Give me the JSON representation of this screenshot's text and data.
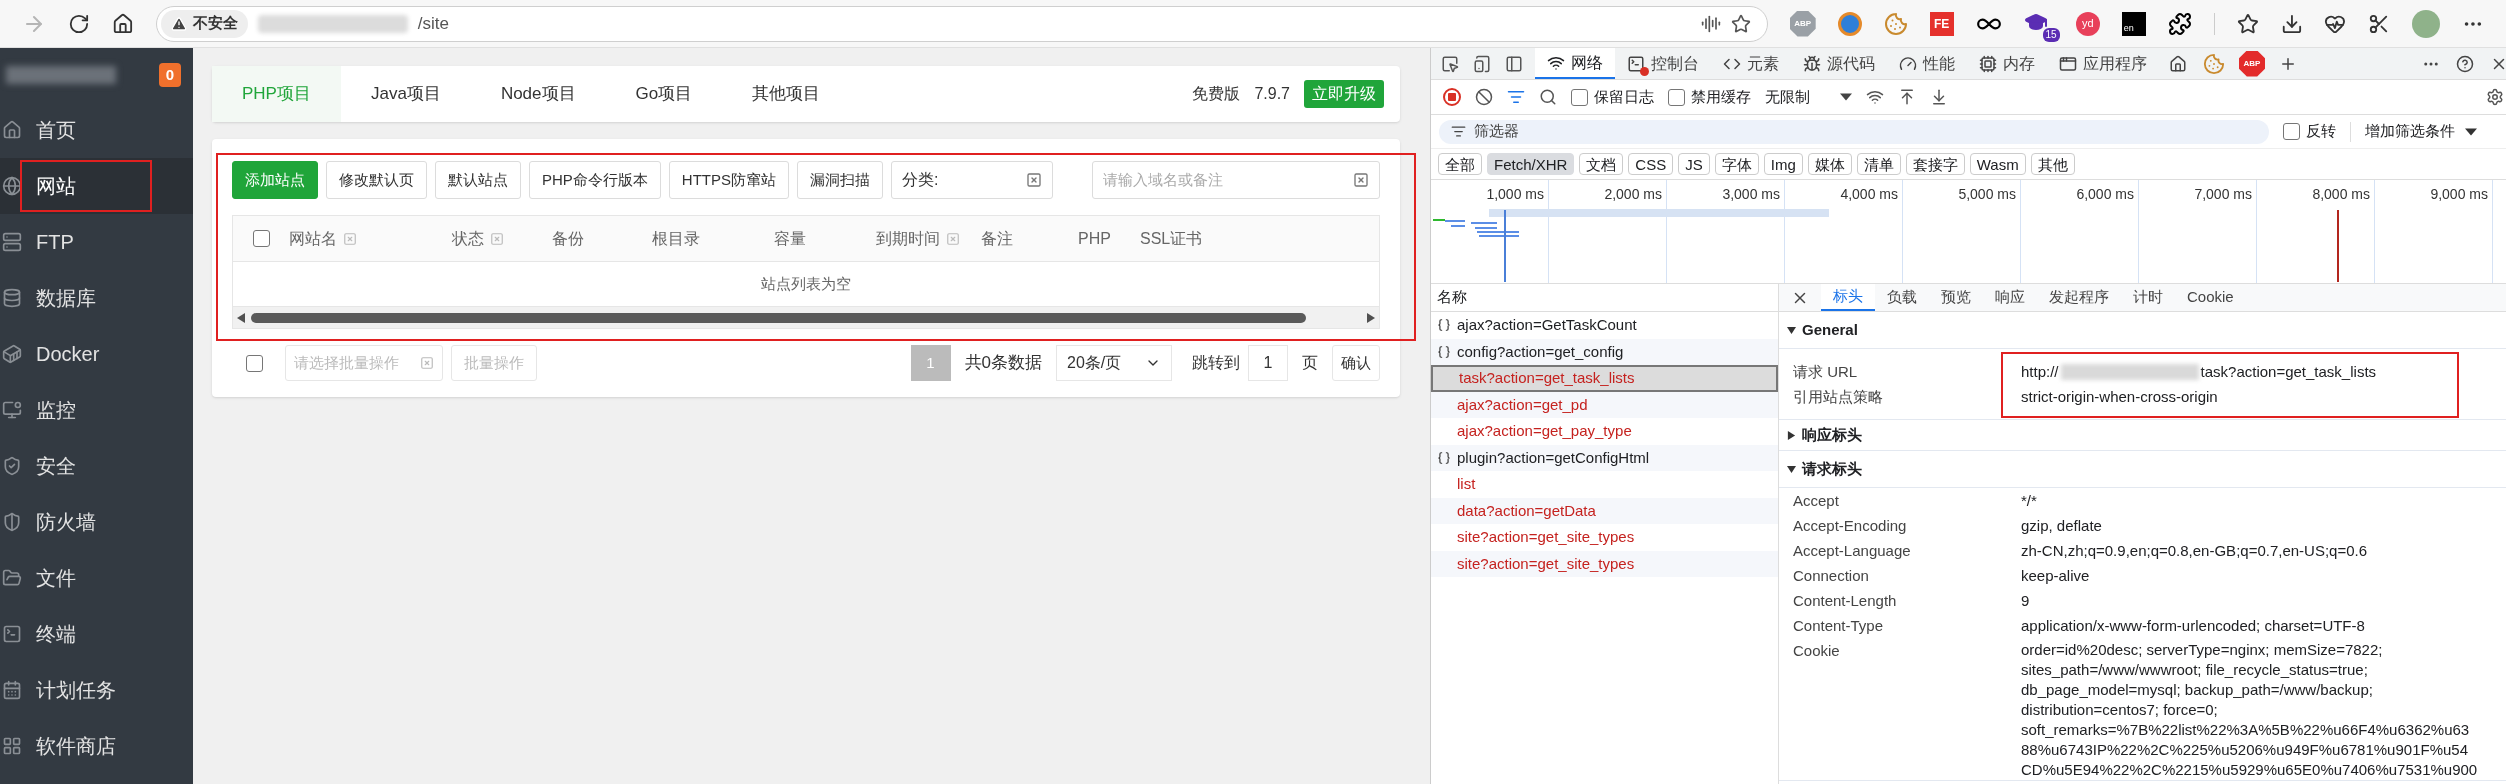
{
  "browser": {
    "back_disabled": true,
    "security_label": "不安全",
    "url_tail": "/site",
    "extensions": [
      {
        "kind": "abp",
        "label": "ABP"
      },
      {
        "kind": "avatar"
      },
      {
        "kind": "cookie"
      },
      {
        "kind": "fe",
        "label": "FE"
      },
      {
        "kind": "infinity"
      },
      {
        "kind": "hat",
        "label": "15"
      },
      {
        "kind": "yd",
        "label": "yd"
      },
      {
        "kind": "en",
        "label": "en"
      },
      {
        "kind": "puzzle"
      }
    ]
  },
  "sidebar": {
    "badge": "0",
    "items": [
      {
        "label": "首页",
        "selected": false
      },
      {
        "label": "网站",
        "selected": true
      },
      {
        "label": "FTP",
        "selected": false
      },
      {
        "label": "数据库",
        "selected": false
      },
      {
        "label": "Docker",
        "selected": false
      },
      {
        "label": "监控",
        "selected": false
      },
      {
        "label": "安全",
        "selected": false
      },
      {
        "label": "防火墙",
        "selected": false
      },
      {
        "label": "文件",
        "selected": false
      },
      {
        "label": "终端",
        "selected": false
      },
      {
        "label": "计划任务",
        "selected": false
      },
      {
        "label": "软件商店",
        "selected": false
      }
    ]
  },
  "project_tabs": [
    {
      "label": "PHP项目",
      "selected": true
    },
    {
      "label": "Java项目",
      "selected": false
    },
    {
      "label": "Node项目",
      "selected": false
    },
    {
      "label": "Go项目",
      "selected": false
    },
    {
      "label": "其他项目",
      "selected": false
    }
  ],
  "edition": {
    "label": "免费版",
    "version": "7.9.7",
    "upgrade": "立即升级"
  },
  "site_toolbar": {
    "buttons": [
      {
        "label": "添加站点",
        "primary": true
      },
      {
        "label": "修改默认页",
        "primary": false
      },
      {
        "label": "默认站点",
        "primary": false
      },
      {
        "label": "PHP命令行版本",
        "primary": false
      },
      {
        "label": "HTTPS防窜站",
        "primary": false
      },
      {
        "label": "漏洞扫描",
        "primary": false
      }
    ],
    "category_label": "分类:",
    "search_placeholder": "请输入域名或备注"
  },
  "site_table": {
    "select_all_checked": false,
    "columns": [
      {
        "label": "网站名",
        "sortable": true
      },
      {
        "label": "状态",
        "sortable": true
      },
      {
        "label": "备份",
        "sortable": false
      },
      {
        "label": "根目录",
        "sortable": false
      },
      {
        "label": "容量",
        "sortable": false
      },
      {
        "label": "到期时间",
        "sortable": true
      },
      {
        "label": "备注",
        "sortable": false
      },
      {
        "label": "PHP",
        "sortable": false
      },
      {
        "label": "SSL证书",
        "sortable": false
      }
    ],
    "empty_text": "站点列表为空"
  },
  "site_footer": {
    "checked": false,
    "batch_placeholder": "请选择批量操作",
    "batch_button": {
      "label": "批量操作",
      "disabled": true
    },
    "pages": [
      {
        "label": "1",
        "selected": true
      }
    ],
    "total": "共0条数据",
    "page_size": "20条/页",
    "jump_label": "跳转到",
    "jump_value": "1",
    "page_unit": "页",
    "confirm": "确认"
  },
  "devtools": {
    "tabs": [
      {
        "label": "网络",
        "selected": true,
        "error": false
      },
      {
        "label": "控制台",
        "selected": false,
        "error": true
      },
      {
        "label": "元素",
        "selected": false,
        "error": false
      },
      {
        "label": "源代码",
        "selected": false,
        "error": false
      },
      {
        "label": "性能",
        "selected": false,
        "error": false
      },
      {
        "label": "内存",
        "selected": false,
        "error": false
      },
      {
        "label": "应用程序",
        "selected": false,
        "error": false
      }
    ],
    "abp_label": "ABP",
    "toolbar": {
      "recording": true,
      "preserve_log": {
        "label": "保留日志",
        "checked": false
      },
      "disable_cache": {
        "label": "禁用缓存",
        "checked": false
      },
      "throttle": "无限制"
    },
    "filter": {
      "placeholder": "筛选器",
      "invert": {
        "label": "反转",
        "checked": false
      },
      "add_filter": "增加筛选条件"
    },
    "type_chips": [
      {
        "label": "全部",
        "selected": false
      },
      {
        "label": "Fetch/XHR",
        "selected": true
      },
      {
        "label": "文档",
        "selected": false
      },
      {
        "label": "CSS",
        "selected": false
      },
      {
        "label": "JS",
        "selected": false
      },
      {
        "label": "字体",
        "selected": false
      },
      {
        "label": "Img",
        "selected": false
      },
      {
        "label": "媒体",
        "selected": false
      },
      {
        "label": "清单",
        "selected": false
      },
      {
        "label": "套接字",
        "selected": false
      },
      {
        "label": "Wasm",
        "selected": false
      },
      {
        "label": "其他",
        "selected": false
      }
    ],
    "timeline_ticks": [
      "1,000 ms",
      "2,000 ms",
      "3,000 ms",
      "4,000 ms",
      "5,000 ms",
      "6,000 ms",
      "7,000 ms",
      "8,000 ms",
      "9,000 ms"
    ],
    "requests": {
      "header": "名称",
      "rows": [
        {
          "name": "ajax?action=GetTaskCount",
          "kind": "fetch",
          "failed": false,
          "selected": false
        },
        {
          "name": "config?action=get_config",
          "kind": "fetch",
          "failed": false,
          "selected": false
        },
        {
          "name": "task?action=get_task_lists",
          "kind": "xhr",
          "failed": true,
          "selected": true
        },
        {
          "name": "ajax?action=get_pd",
          "kind": "xhr",
          "failed": true,
          "selected": false
        },
        {
          "name": "ajax?action=get_pay_type",
          "kind": "xhr",
          "failed": true,
          "selected": false
        },
        {
          "name": "plugin?action=getConfigHtml",
          "kind": "fetch",
          "failed": false,
          "selected": false
        },
        {
          "name": "list",
          "kind": "xhr",
          "failed": true,
          "selected": false
        },
        {
          "name": "data?action=getData",
          "kind": "xhr",
          "failed": true,
          "selected": false
        },
        {
          "name": "site?action=get_site_types",
          "kind": "xhr",
          "failed": true,
          "selected": false
        },
        {
          "name": "site?action=get_site_types",
          "kind": "xhr",
          "failed": true,
          "selected": false
        }
      ]
    },
    "detail_tabs": [
      {
        "label": "标头",
        "selected": true
      },
      {
        "label": "负载",
        "selected": false
      },
      {
        "label": "预览",
        "selected": false
      },
      {
        "label": "响应",
        "selected": false
      },
      {
        "label": "发起程序",
        "selected": false
      },
      {
        "label": "计时",
        "selected": false
      },
      {
        "label": "Cookie",
        "selected": false
      }
    ],
    "sections": [
      {
        "title": "General",
        "expanded": true,
        "highlighted": true,
        "rows": [
          {
            "name": "请求 URL",
            "value": "http://",
            "redacted": true,
            "value_tail": "task?action=get_task_lists"
          },
          {
            "name": "引用站点策略",
            "value": "strict-origin-when-cross-origin"
          }
        ]
      },
      {
        "title": "响应标头",
        "expanded": false
      },
      {
        "title": "请求标头",
        "expanded": true,
        "rows": [
          {
            "name": "Accept",
            "value": "*/*"
          },
          {
            "name": "Accept-Encoding",
            "value": "gzip, deflate"
          },
          {
            "name": "Accept-Language",
            "value": "zh-CN,zh;q=0.9,en;q=0.8,en-GB;q=0.7,en-US;q=0.6"
          },
          {
            "name": "Connection",
            "value": "keep-alive"
          },
          {
            "name": "Content-Length",
            "value": "9"
          },
          {
            "name": "Content-Type",
            "value": "application/x-www-form-urlencoded; charset=UTF-8"
          },
          {
            "name": "Cookie",
            "value_lines": [
              "order=id%20desc; serverType=nginx; memSize=7822;",
              "sites_path=/www/wwwroot; file_recycle_status=true;",
              "db_page_model=mysql; backup_path=/www/backup;",
              "distribution=centos7; force=0;",
              "soft_remarks=%7B%22list%22%3A%5B%22%u66F4%u6362%u63",
              "88%u6743IP%22%2C%225%u5206%u949F%u6781%u901F%u54",
              "CD%u5E94%22%2C%2215%u5929%u65E0%u7406%u7531%u900"
            ]
          }
        ]
      }
    ]
  }
}
